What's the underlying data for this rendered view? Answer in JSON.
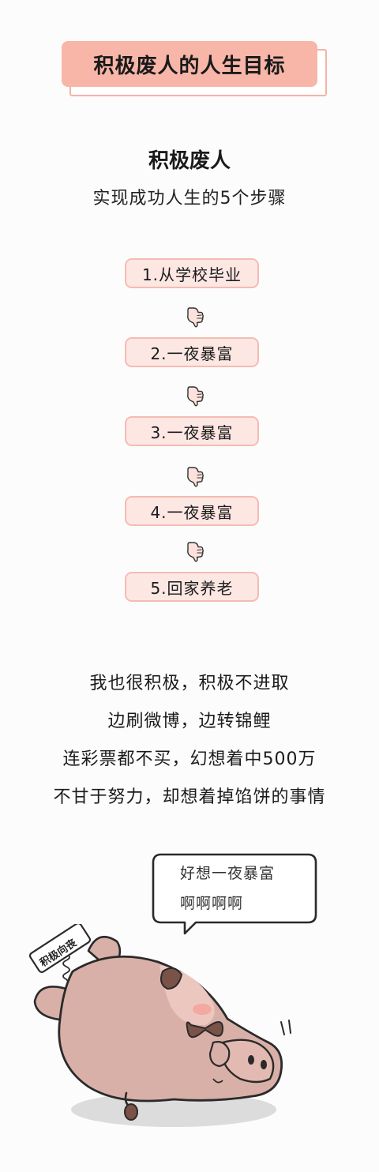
{
  "header": {
    "title": "积极废人的人生目标"
  },
  "intro": {
    "title": "积极废人",
    "subtitle": "实现成功人生的5个步骤"
  },
  "steps": [
    {
      "label": "1.从学校毕业"
    },
    {
      "label": "2.一夜暴富"
    },
    {
      "label": "3.一夜暴富"
    },
    {
      "label": "4.一夜暴富"
    },
    {
      "label": "5.回家养老"
    }
  ],
  "paragraph": {
    "lines": [
      "我也很积极，积极不进取",
      "边刷微博，边转锦鲤",
      "连彩票都不买，幻想着中500万",
      "不甘于努力，却想着掉馅饼的事情"
    ]
  },
  "illustration": {
    "speech": [
      "好想一夜暴富",
      "啊啊啊啊"
    ],
    "sign": "积极向丧"
  },
  "icons": {
    "step_pointer": "pointing-down-hand-icon"
  },
  "colors": {
    "banner": "#f7b6a8",
    "step_fill": "#fde7e3",
    "step_border": "#f4bcb2",
    "pig_body": "#d8b0a8",
    "pig_shadow": "#d9d9d9"
  }
}
